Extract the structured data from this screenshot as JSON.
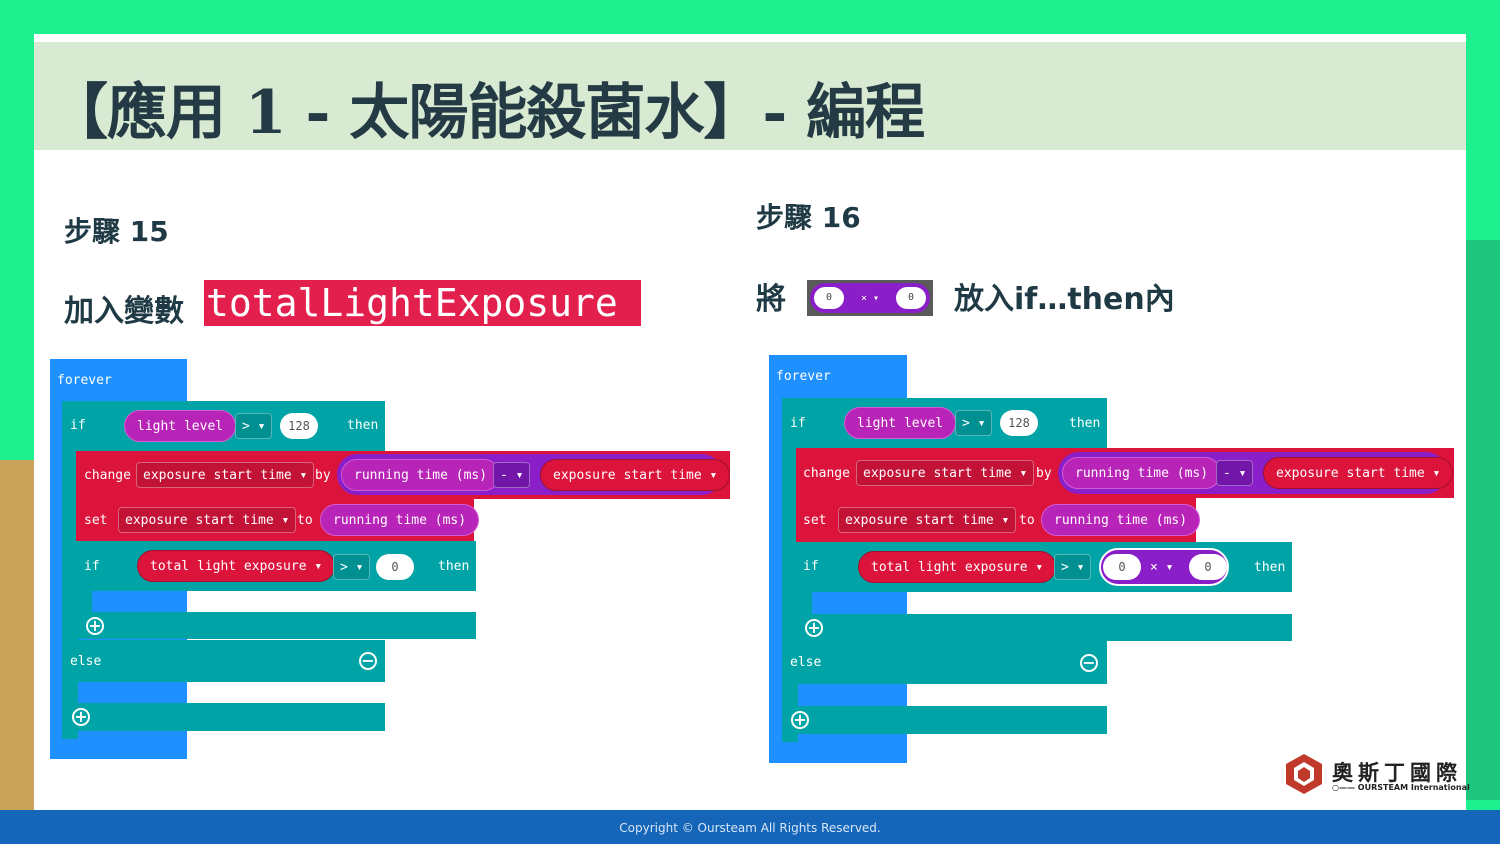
{
  "slide": {
    "title": "【應用 1 - 太陽能殺菌水】- 編程",
    "footer": "Copyright © Oursteam All Rights Reserved."
  },
  "left": {
    "step": "步驟 15",
    "instruction": "加入變數",
    "variable_name": "totalLightExposure"
  },
  "right": {
    "step": "步驟 16",
    "instruction_prefix": "將",
    "instruction_suffix": "放入if…then內",
    "mini_block": {
      "left": "0",
      "op": "× ▾",
      "right": "0"
    }
  },
  "blocks": {
    "forever": "forever",
    "if": "if",
    "then": "then",
    "else": "else",
    "light_level": "light level",
    "gt_op": "> ▾",
    "n128": "128",
    "change": "change",
    "by": "by",
    "set": "set",
    "to": "to",
    "exposure_start_time": "exposure start time ▾",
    "running_time": "running time (ms)",
    "minus_op": "- ▾",
    "total_light_exposure": "total light exposure ▾",
    "zero": "0",
    "times_op": "× ▾",
    "plus": "+",
    "minus": "−"
  },
  "logo": {
    "chinese": "奧斯丁國際",
    "english": "○—— OURSTEAM International"
  },
  "colors": {
    "slide_border": "#1ef08f",
    "title_bar": "#d9ead3",
    "loop_blue": "#1e90ff",
    "logic_teal": "#00a4a6",
    "variable_red": "#dc143c",
    "input_magenta": "#b823b8",
    "math_purple": "#8a1ec9",
    "footer_blue": "#1565b8"
  }
}
